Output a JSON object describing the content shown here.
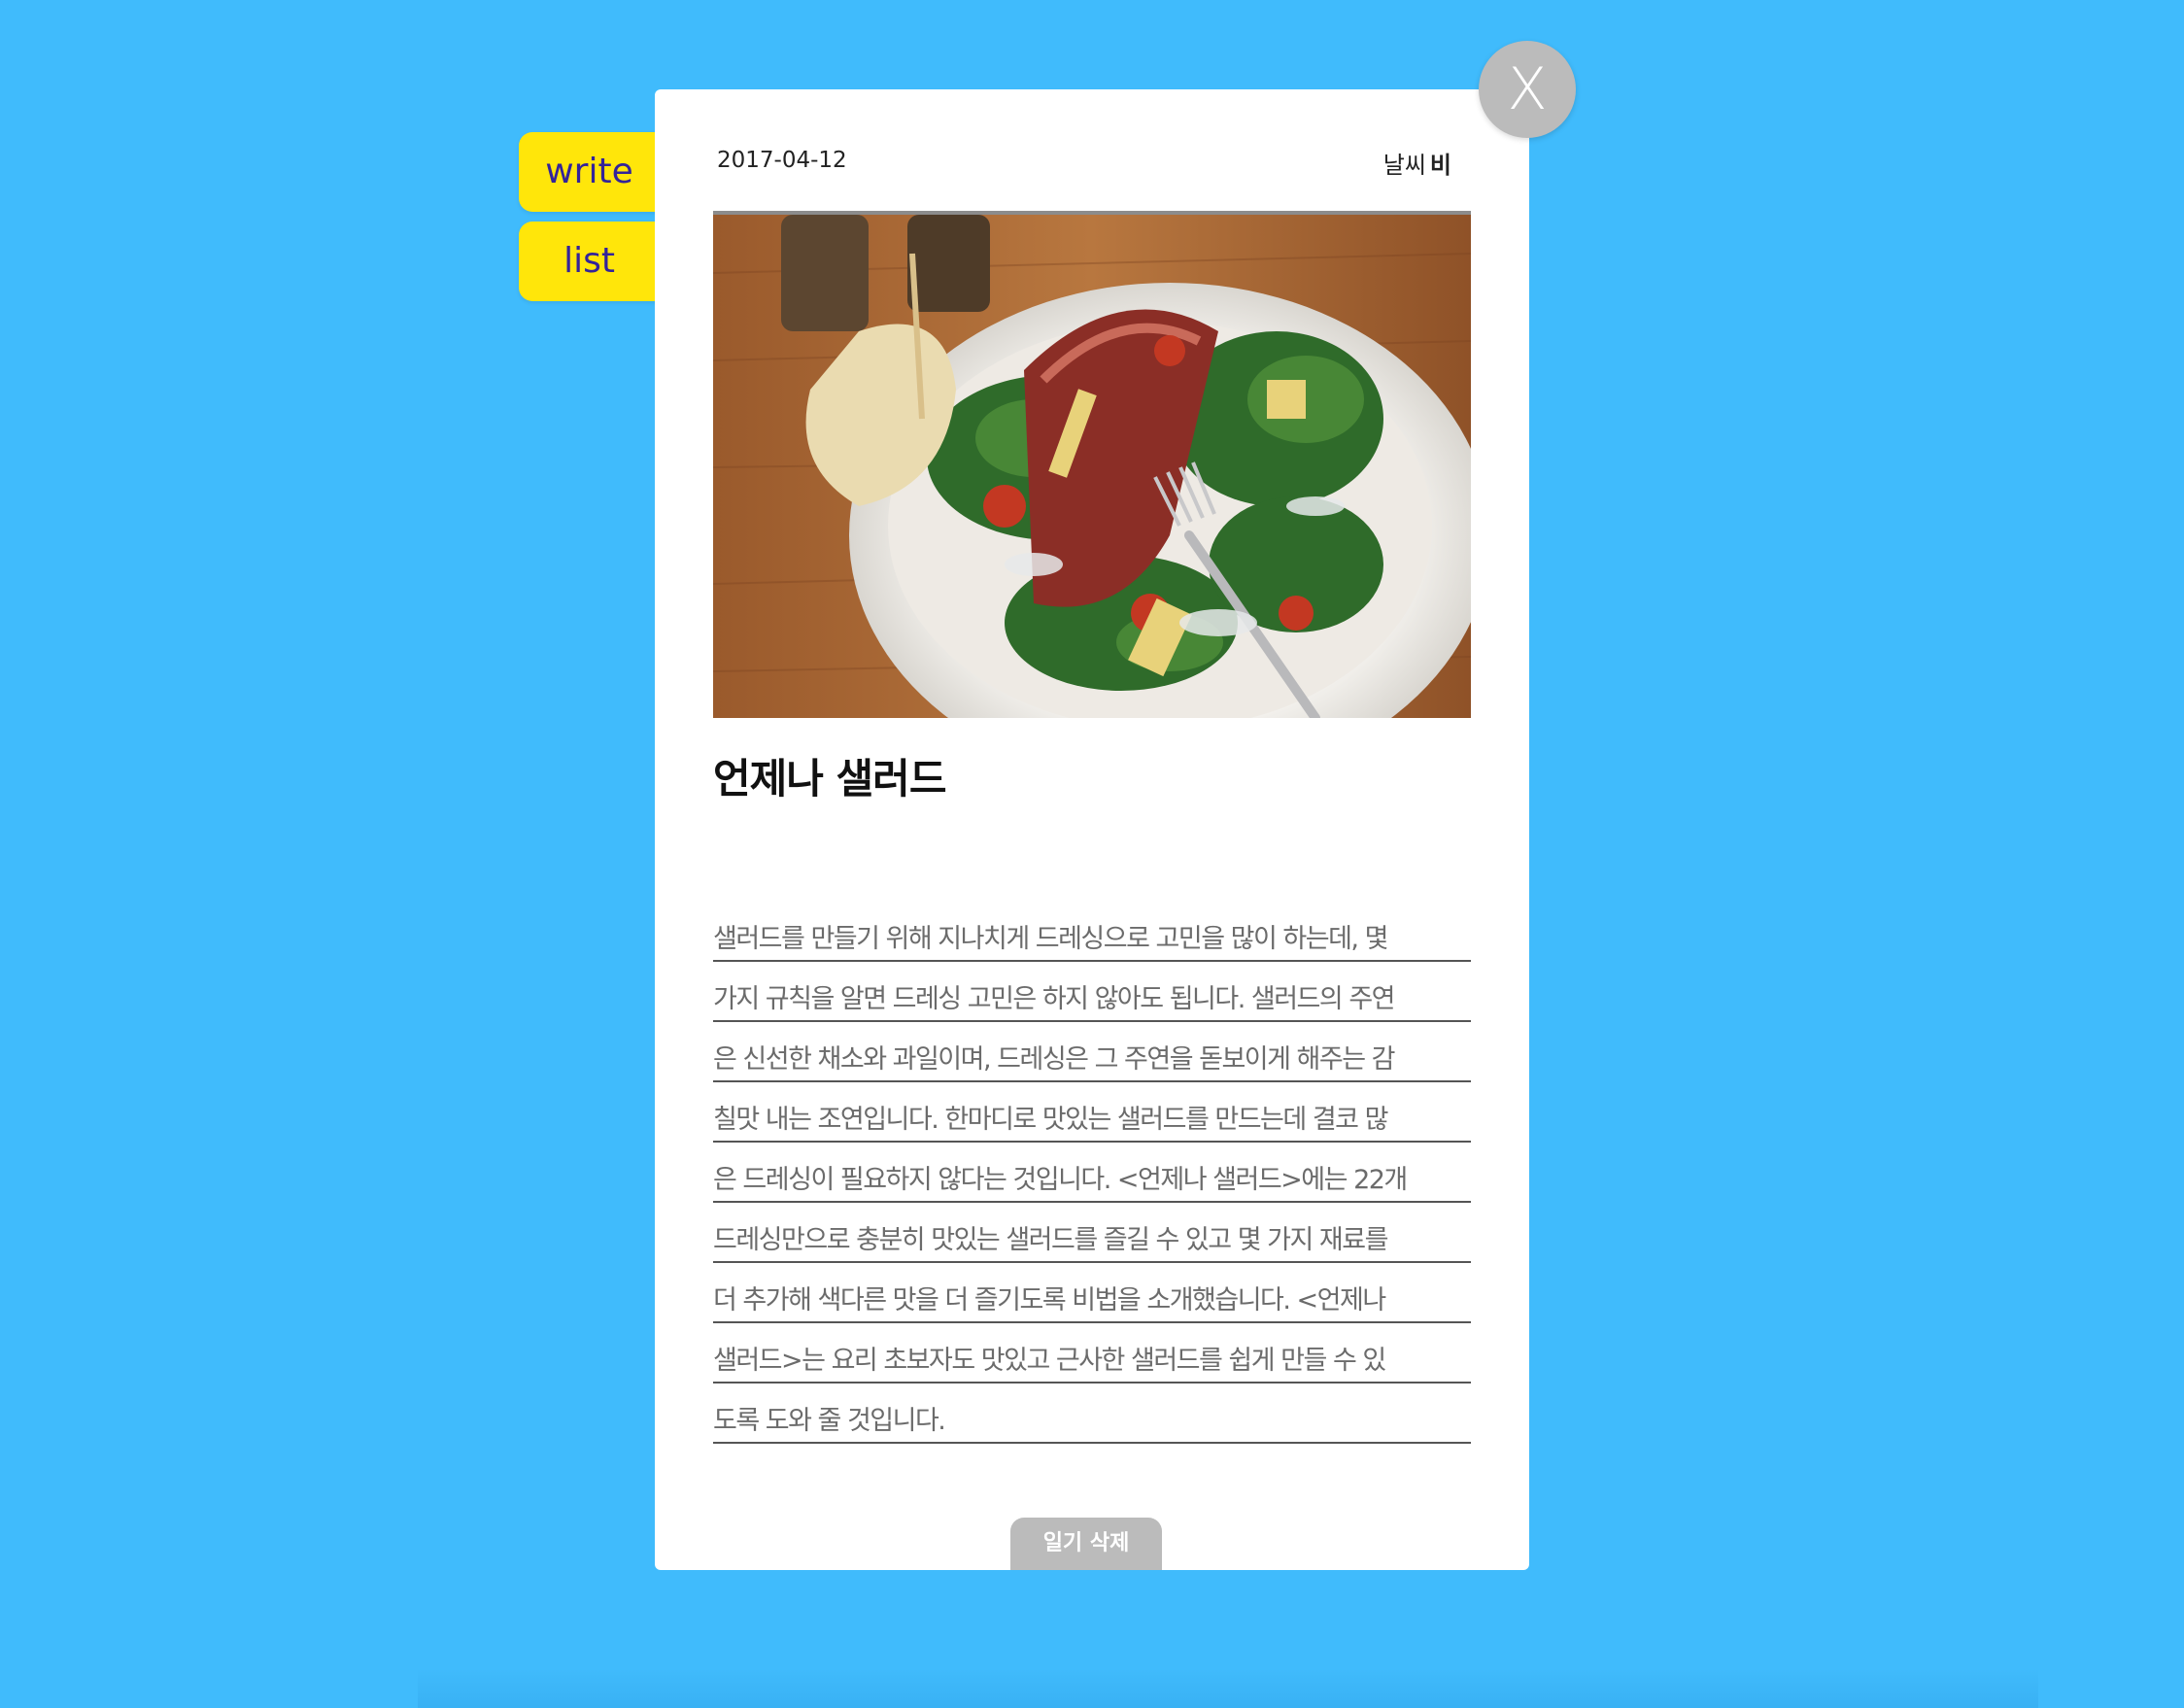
{
  "nav": {
    "write_label": "write",
    "list_label": "list"
  },
  "close_button": {
    "label": "X"
  },
  "entry": {
    "date": "2017-04-12",
    "weather_label": "날씨",
    "weather_value": "비",
    "title": "언제나 샐러드",
    "body_lines": [
      "샐러드를 만들기 위해 지나치게 드레싱으로 고민을 많이 하는데, 몇",
      "가지 규칙을 알면 드레싱 고민은 하지 않아도 됩니다. 샐러드의 주연",
      "은 신선한 채소와 과일이며, 드레싱은 그 주연을 돋보이게 해주는 감",
      "칠맛 내는 조연입니다. 한마디로 맛있는 샐러드를 만드는데 결코 많",
      "은 드레싱이 필요하지 않다는 것입니다. <언제나 샐러드>에는 22개",
      "드레싱만으로 충분히 맛있는 샐러드를 즐길 수 있고 몇 가지 재료를",
      "더 추가해 색다른 맛을 더 즐기도록 비법을 소개했습니다. <언제나",
      "샐러드>는 요리 초보자도 맛있고 근사한 샐러드를 쉽게 만들 수 있",
      "도록 도와 줄 것입니다."
    ],
    "delete_label": "일기 삭제"
  },
  "colors": {
    "background": "#40bbfc",
    "tab": "#ffe60a",
    "tab_text": "#33239a",
    "close_button": "#bbbbbb",
    "delete_button": "#bbbbbb"
  }
}
